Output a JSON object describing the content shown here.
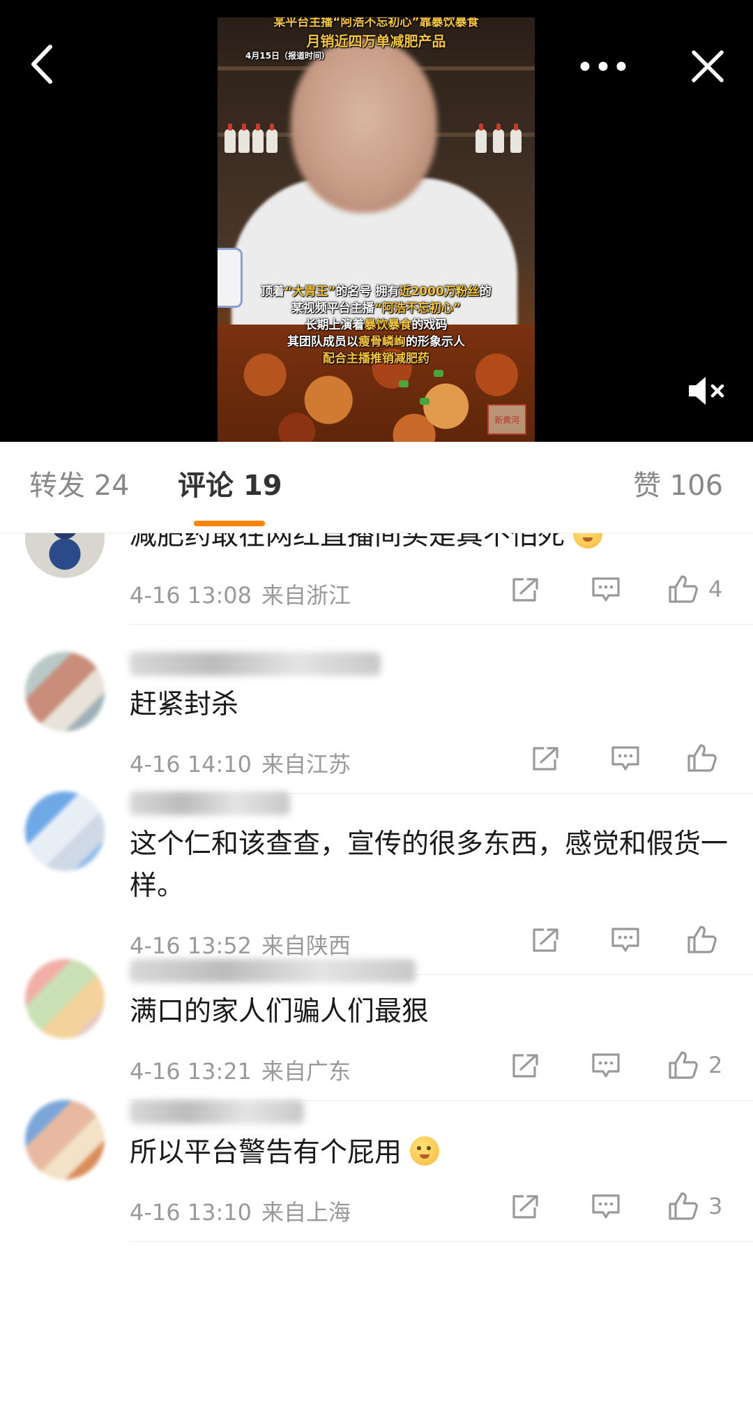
{
  "video": {
    "headline_top": "某平台主播“阿浩不忘初心”靠暴饮暴食",
    "headline_sub": "月销近四万单减肥产品",
    "date": "4月15日（报道时间）",
    "caption_l1_pre": "顶着",
    "caption_l1_hl1": "“大胃王”",
    "caption_l1_mid": "的名号 拥有",
    "caption_l1_hl2": "近2000万粉丝",
    "caption_l1_post": "的",
    "caption_l2_pre": "某视频平台主播",
    "caption_l2_hl": "“阿浩不忘初心”",
    "caption_l3_pre": "长期上演着",
    "caption_l3_hl": "暴饮暴食",
    "caption_l3_post": "的戏码",
    "caption_l4_pre": "其团队成员以",
    "caption_l4_hl": "瘦骨嶙峋",
    "caption_l4_post": "的形象示人",
    "caption_l5": "配合主播推销减肥药",
    "seal_text": "新黄河",
    "icons": {
      "back": "back-arrow-icon",
      "more": "more-dots-icon",
      "close": "close-icon",
      "mute": "mute-icon"
    }
  },
  "tabs": {
    "repost_label": "转发",
    "repost_count": "24",
    "comment_label": "评论",
    "comment_count": "19",
    "like_label": "赞",
    "like_count": "106",
    "accent": "#ff8200"
  },
  "comments": [
    {
      "text": "减肥药敢在网红直播间买是真不怕死",
      "emoji": true,
      "time": "4-16 13:08",
      "location": "来自浙江",
      "likes": "4"
    },
    {
      "text": "赶紧封杀",
      "emoji": false,
      "time": "4-16 14:10",
      "location": "来自江苏",
      "likes": ""
    },
    {
      "text": "这个仁和该查查，宣传的很多东西，感觉和假货一样。",
      "emoji": false,
      "time": "4-16 13:52",
      "location": "来自陕西",
      "likes": ""
    },
    {
      "text": "满口的家人们骗人们最狠",
      "emoji": false,
      "time": "4-16 13:21",
      "location": "来自广东",
      "likes": "2"
    },
    {
      "text": "所以平台警告有个屁用",
      "emoji": true,
      "time": "4-16 13:10",
      "location": "来自上海",
      "likes": "3"
    }
  ]
}
